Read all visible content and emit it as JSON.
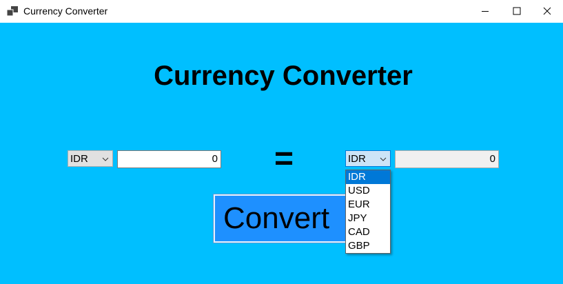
{
  "window": {
    "title": "Currency Converter"
  },
  "heading": "Currency Converter",
  "from": {
    "currency": "IDR",
    "amount": "0"
  },
  "equals": "=",
  "to": {
    "currency": "IDR",
    "amount": "0"
  },
  "convert_label": "Convert",
  "dropdown": {
    "options": [
      "IDR",
      "USD",
      "EUR",
      "JPY",
      "CAD",
      "GBP"
    ],
    "selected": "IDR"
  },
  "colors": {
    "background": "#00BFFF",
    "button": "#1E90FF",
    "selection": "#0078D7"
  },
  "icons": [
    "app-icon",
    "minimize-icon",
    "maximize-icon",
    "close-icon",
    "chevron-down-icon"
  ]
}
